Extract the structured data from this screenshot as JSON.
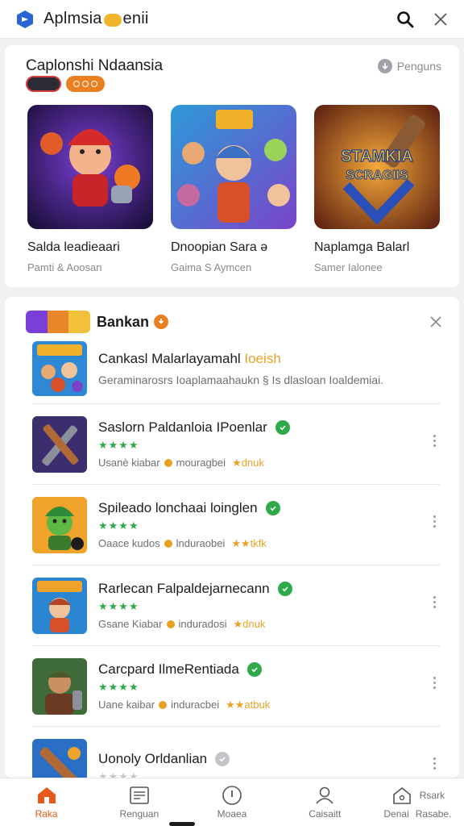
{
  "header": {
    "title_left": "Aplmsia",
    "title_right": "enii",
    "logo_icon": "app-logo-icon",
    "search_icon": "search-icon",
    "close_icon": "close-icon"
  },
  "featured": {
    "title": "Caplonshi Ndaansia",
    "link_label": "Penguns",
    "games": [
      {
        "name": "Salda leadieaari",
        "sub": "Pamti & Aoosan"
      },
      {
        "name": "Dnoopian Sara ə",
        "sub": "Gaima S Aymcen"
      },
      {
        "name": "Naplamga Balarl",
        "sub": "Samer Ialonee"
      }
    ],
    "art_text": "STAMKIA SCRAGIIS"
  },
  "list": {
    "title": "Bankan",
    "promo": {
      "title": "Cankasl Malarlayamahl",
      "title_highlight": "Ioeish",
      "desc": "Geraminarosrs Ioaplamaahaukn § Is dlasloan Ioaldemiai."
    },
    "rows": [
      {
        "title": "Saslorn Paldanloia IPoenlar",
        "stars": "★★★★",
        "meta_left": "Usanè kiabar",
        "meta_mid": "mouragbei",
        "meta_tag": "★dnuk",
        "verified": true
      },
      {
        "title": "Spileado lonchaai loinglen",
        "stars": "★★★★",
        "meta_left": "Oaace kudos",
        "meta_mid": "lnduraobei",
        "meta_tag": "★★tkfk",
        "verified": true
      },
      {
        "title": "Rarlecan Falpaldejarnecann",
        "stars": "★★★★",
        "meta_left": "Gsane Kiabar",
        "meta_mid": "induradosi",
        "meta_tag": "★dnuk",
        "verified": true
      },
      {
        "title": "Carcpard IlmeRentiada",
        "stars": "★★★★",
        "meta_left": "Uane kaibar",
        "meta_mid": "induracbei",
        "meta_tag": "★★atbuk",
        "verified": true
      },
      {
        "title": "Uonoly Orldanlian",
        "stars": "★★★★",
        "meta_left": "",
        "meta_mid": "",
        "meta_tag": "",
        "verified": false
      }
    ]
  },
  "nav": [
    {
      "label": "Raka",
      "icon": "home-icon",
      "active": true
    },
    {
      "label": "Renguan",
      "icon": "list-icon",
      "active": false
    },
    {
      "label": "Moaea",
      "icon": "info-icon",
      "active": false
    },
    {
      "label": "Caisaitt",
      "icon": "user-icon",
      "active": false
    },
    {
      "label": "Denai",
      "label2": "Rsark",
      "label3": "Rasabe.",
      "icon": "home-badge-icon",
      "active": false
    }
  ],
  "colors": {
    "accent": "#e55a1c",
    "verified": "#2faa4b",
    "orange": "#e97f1f"
  }
}
